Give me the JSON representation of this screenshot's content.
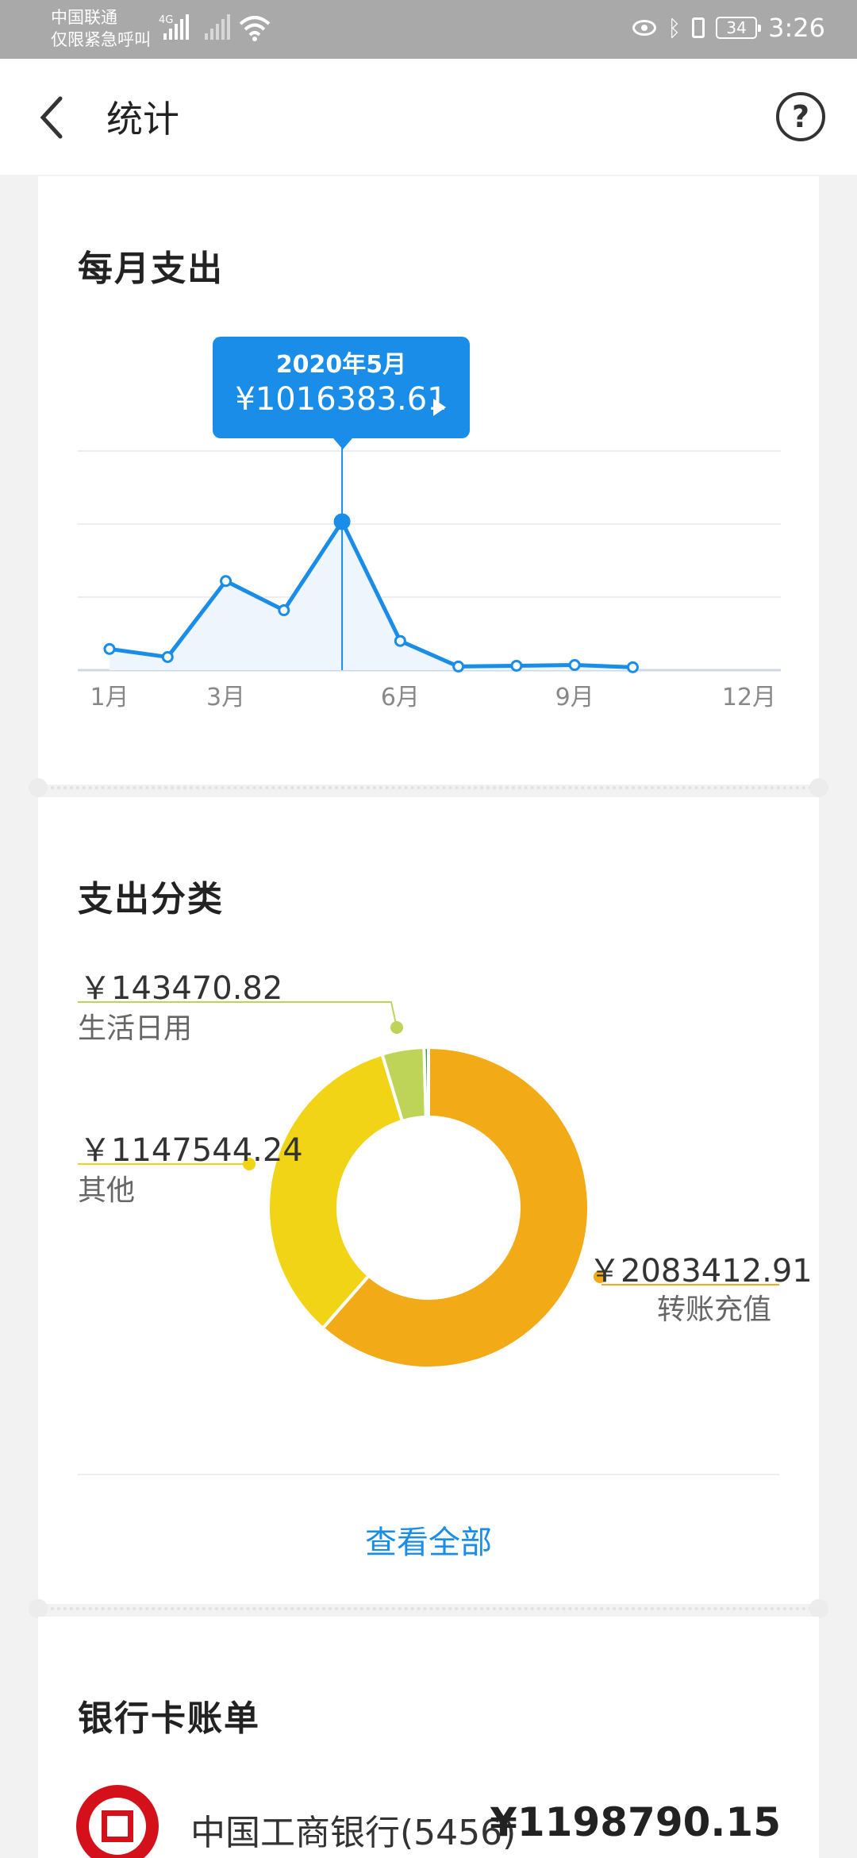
{
  "status_bar": {
    "carrier_line1": "中国联通",
    "carrier_line2": "仅限紧急呼叫",
    "network": "4G",
    "battery": "34",
    "time": "3:26"
  },
  "header": {
    "title": "统计",
    "help_label": "?"
  },
  "monthly": {
    "title": "每月支出",
    "tooltip_month": "2020年5月",
    "tooltip_amount": "¥1016383.61"
  },
  "chart_data": [
    {
      "type": "line",
      "title": "每月支出",
      "x": [
        1,
        2,
        3,
        4,
        5,
        6,
        7,
        8,
        9,
        10
      ],
      "values": [
        145000,
        90000,
        610000,
        410000,
        1016383.61,
        200000,
        25000,
        30000,
        35000,
        20000
      ],
      "x_ticks": [
        1,
        3,
        6,
        9,
        12
      ],
      "x_tick_labels": [
        "1月",
        "3月",
        "6月",
        "9月",
        "12月"
      ],
      "xlim": [
        1,
        12
      ],
      "ylim": [
        0,
        1500000
      ],
      "grid": true,
      "highlight_index": 4,
      "color": "#1a8de9"
    },
    {
      "type": "pie",
      "title": "支出分类",
      "labels": [
        "转账充值",
        "其他",
        "生活日用",
        ""
      ],
      "values": [
        2083412.91,
        1147544.24,
        143470.82,
        15000
      ],
      "colors": [
        "#f2aa16",
        "#f2d416",
        "#bed458",
        "#3b9a4c"
      ]
    }
  ],
  "category": {
    "title": "支出分类",
    "items": [
      {
        "amount": "￥143470.82",
        "label": "生活日用"
      },
      {
        "amount": "￥1147544.24",
        "label": "其他"
      },
      {
        "amount": "￥2083412.91",
        "label": "转账充值"
      }
    ],
    "view_all": "查看全部"
  },
  "bank": {
    "title": "银行卡账单",
    "name": "中国工商银行(5456)",
    "amount": "¥1198790.15"
  }
}
